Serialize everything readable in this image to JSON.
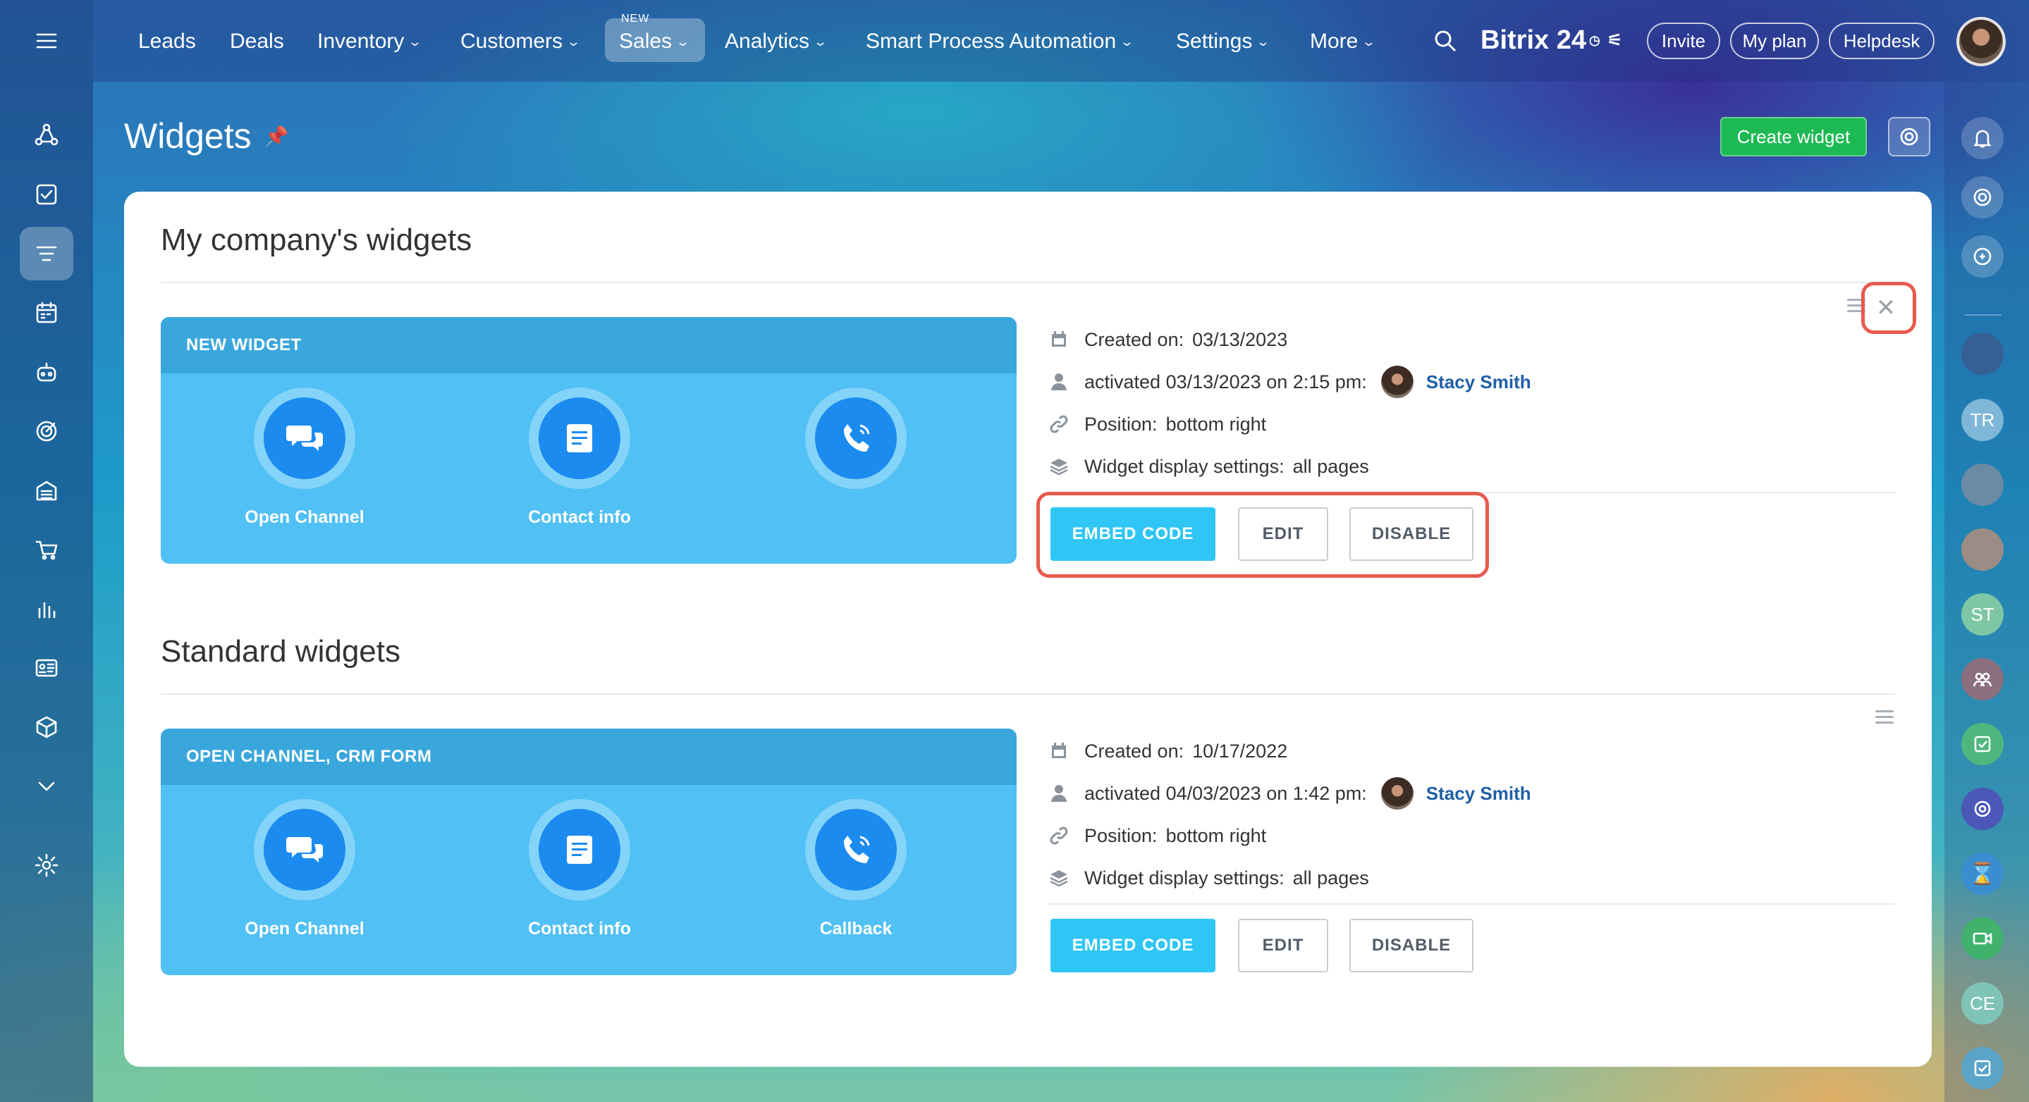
{
  "topbar": {
    "nav": [
      {
        "label": "Leads",
        "chevron": false
      },
      {
        "label": "Deals",
        "chevron": false
      },
      {
        "label": "Inventory",
        "chevron": true
      },
      {
        "label": "Customers",
        "chevron": true
      },
      {
        "label": "Sales",
        "chevron": true,
        "active": true,
        "tag": "NEW"
      },
      {
        "label": "Analytics",
        "chevron": true
      },
      {
        "label": "Smart Process Automation",
        "chevron": true
      },
      {
        "label": "Settings",
        "chevron": true
      },
      {
        "label": "More",
        "chevron": true
      }
    ],
    "brand": "Bitrix 24",
    "invite": "Invite",
    "my_plan": "My plan",
    "helpdesk": "Helpdesk"
  },
  "page": {
    "title": "Widgets",
    "create_widget": "Create widget"
  },
  "sections": [
    {
      "title": "My company's widgets",
      "widget": {
        "header": "NEW WIDGET",
        "channels": [
          "Open Channel",
          "Contact info",
          ""
        ],
        "created_label": "Created on:",
        "created": "03/13/2023",
        "activated": "activated 03/13/2023 on 2:15 pm:",
        "user": "Stacy Smith",
        "position_label": "Position:",
        "position": "bottom right",
        "display_label": "Widget display settings:",
        "display": "all pages",
        "buttons": {
          "embed": "EMBED CODE",
          "edit": "EDIT",
          "disable": "DISABLE"
        }
      }
    },
    {
      "title": "Standard widgets",
      "widget": {
        "header": "OPEN CHANNEL, CRM FORM",
        "channels": [
          "Open Channel",
          "Contact info",
          "Callback"
        ],
        "created_label": "Created on:",
        "created": "10/17/2022",
        "activated": "activated 04/03/2023 on 1:42 pm:",
        "user": "Stacy Smith",
        "position_label": "Position:",
        "position": "bottom right",
        "display_label": "Widget display settings:",
        "display": "all pages",
        "buttons": {
          "embed": "EMBED CODE",
          "edit": "EDIT",
          "disable": "DISABLE"
        }
      }
    }
  ],
  "right_bar": {
    "initials": [
      "TR",
      "ST",
      "CE"
    ]
  },
  "colors": {
    "accent_green": "#1db954",
    "embed_blue": "#2fc6f6",
    "card_blue": "#50c0f5",
    "highlight_red": "#e85a4f",
    "user_link": "#1f5fa8"
  }
}
